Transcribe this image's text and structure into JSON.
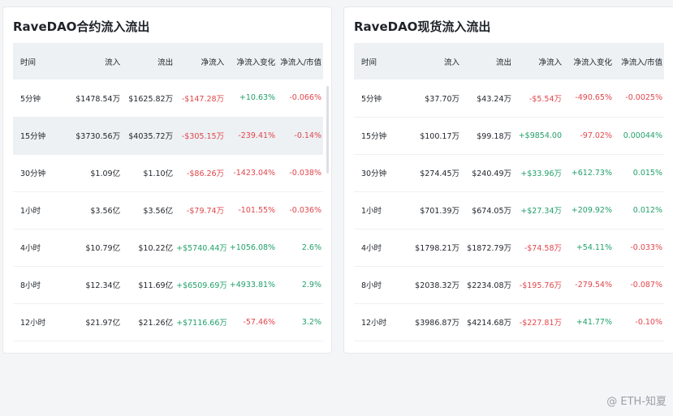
{
  "columns": [
    "时间",
    "流入",
    "流出",
    "净流入",
    "净流入变化",
    "净流入/市值"
  ],
  "futures": {
    "title": "RaveDAO合约流入流出",
    "rows": [
      {
        "time": "5分钟",
        "inflow": "$1478.54万",
        "outflow": "$1625.82万",
        "net": "-$147.28万",
        "change": "+10.63%",
        "ratio": "-0.066%",
        "netSign": "neg",
        "changeSign": "pos",
        "ratioSign": "neg"
      },
      {
        "time": "15分钟",
        "inflow": "$3730.56万",
        "outflow": "$4035.72万",
        "net": "-$305.15万",
        "change": "-239.41%",
        "ratio": "-0.14%",
        "netSign": "neg",
        "changeSign": "neg",
        "ratioSign": "neg"
      },
      {
        "time": "30分钟",
        "inflow": "$1.09亿",
        "outflow": "$1.10亿",
        "net": "-$86.26万",
        "change": "-1423.04%",
        "ratio": "-0.038%",
        "netSign": "neg",
        "changeSign": "neg",
        "ratioSign": "neg"
      },
      {
        "time": "1小时",
        "inflow": "$3.56亿",
        "outflow": "$3.56亿",
        "net": "-$79.74万",
        "change": "-101.55%",
        "ratio": "-0.036%",
        "netSign": "neg",
        "changeSign": "neg",
        "ratioSign": "neg"
      },
      {
        "time": "4小时",
        "inflow": "$10.79亿",
        "outflow": "$10.22亿",
        "net": "+$5740.44万",
        "change": "+1056.08%",
        "ratio": "2.6%",
        "netSign": "pos",
        "changeSign": "pos",
        "ratioSign": "pos"
      },
      {
        "time": "8小时",
        "inflow": "$12.34亿",
        "outflow": "$11.69亿",
        "net": "+$6509.69万",
        "change": "+4933.81%",
        "ratio": "2.9%",
        "netSign": "pos",
        "changeSign": "pos",
        "ratioSign": "pos"
      },
      {
        "time": "12小时",
        "inflow": "$21.97亿",
        "outflow": "$21.26亿",
        "net": "+$7116.66万",
        "change": "-57.46%",
        "ratio": "3.2%",
        "netSign": "pos",
        "changeSign": "neg",
        "ratioSign": "pos"
      }
    ]
  },
  "spot": {
    "title": "RaveDAO现货流入流出",
    "rows": [
      {
        "time": "5分钟",
        "inflow": "$37.70万",
        "outflow": "$43.24万",
        "net": "-$5.54万",
        "change": "-490.65%",
        "ratio": "-0.0025%",
        "netSign": "neg",
        "changeSign": "neg",
        "ratioSign": "neg"
      },
      {
        "time": "15分钟",
        "inflow": "$100.17万",
        "outflow": "$99.18万",
        "net": "+$9854.00",
        "change": "-97.02%",
        "ratio": "0.00044%",
        "netSign": "pos",
        "changeSign": "neg",
        "ratioSign": "pos"
      },
      {
        "time": "30分钟",
        "inflow": "$274.45万",
        "outflow": "$240.49万",
        "net": "+$33.96万",
        "change": "+612.73%",
        "ratio": "0.015%",
        "netSign": "pos",
        "changeSign": "pos",
        "ratioSign": "pos"
      },
      {
        "time": "1小时",
        "inflow": "$701.39万",
        "outflow": "$674.05万",
        "net": "+$27.34万",
        "change": "+209.92%",
        "ratio": "0.012%",
        "netSign": "pos",
        "changeSign": "pos",
        "ratioSign": "pos"
      },
      {
        "time": "4小时",
        "inflow": "$1798.21万",
        "outflow": "$1872.79万",
        "net": "-$74.58万",
        "change": "+54.11%",
        "ratio": "-0.033%",
        "netSign": "neg",
        "changeSign": "pos",
        "ratioSign": "neg"
      },
      {
        "time": "8小时",
        "inflow": "$2038.32万",
        "outflow": "$2234.08万",
        "net": "-$195.76万",
        "change": "-279.54%",
        "ratio": "-0.087%",
        "netSign": "neg",
        "changeSign": "neg",
        "ratioSign": "neg"
      },
      {
        "time": "12小时",
        "inflow": "$3986.87万",
        "outflow": "$4214.68万",
        "net": "-$227.81万",
        "change": "+41.77%",
        "ratio": "-0.10%",
        "netSign": "neg",
        "changeSign": "pos",
        "ratioSign": "neg"
      }
    ]
  },
  "watermark": "@ ETH-知夏",
  "colors": {
    "negative": "#e0464b",
    "positive": "#22a06b",
    "header_bg": "#edf1f4"
  }
}
